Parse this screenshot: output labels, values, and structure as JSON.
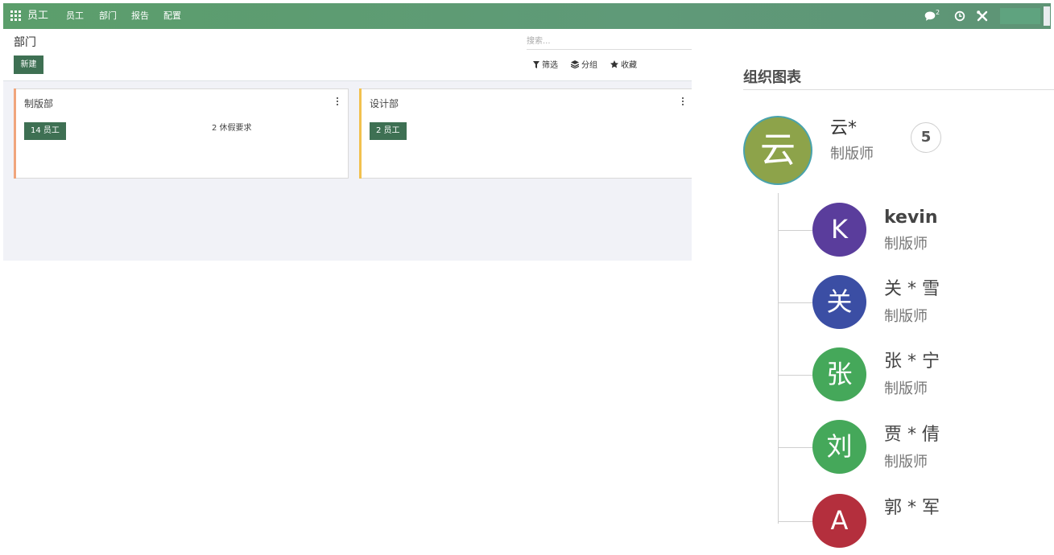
{
  "navbar": {
    "brand": "员工",
    "menus": [
      "员工",
      "部门",
      "报告",
      "配置"
    ],
    "chat_count": "2",
    "bg_color": "#5b9e6b"
  },
  "control_panel": {
    "title": "部门",
    "new_button": "新建",
    "search_placeholder": "搜索...",
    "filter_label": "筛选",
    "group_label": "分组",
    "favorite_label": "收藏"
  },
  "kanban": {
    "cards": [
      {
        "name": "制版部",
        "employees_label": "14 员工",
        "leave_label": "2 休假要求",
        "stripe_color": "#f0a57c"
      },
      {
        "name": "设计部",
        "employees_label": "2 员工",
        "leave_label": "",
        "stripe_color": "#f2c14e"
      }
    ]
  },
  "org_chart": {
    "title": "组织图表",
    "manager": {
      "initial": "云",
      "name": "云*",
      "job": "制版师",
      "subordinate_count": "5",
      "color": "#8da34a"
    },
    "subordinates": [
      {
        "initial": "K",
        "name": "kevin",
        "job": "制版师",
        "color": "#5a3d9c"
      },
      {
        "initial": "关",
        "name": "关 * 雪",
        "job": "制版师",
        "color": "#3b4ea4"
      },
      {
        "initial": "张",
        "name": "张 * 宁",
        "job": "制版师",
        "color": "#45a85a"
      },
      {
        "initial": "刘",
        "name": "贾 * 倩",
        "job": "制版师",
        "color": "#45a85a"
      },
      {
        "initial": "A",
        "name": "郭 * 军",
        "job": "",
        "color": "#b42f3d"
      }
    ]
  }
}
